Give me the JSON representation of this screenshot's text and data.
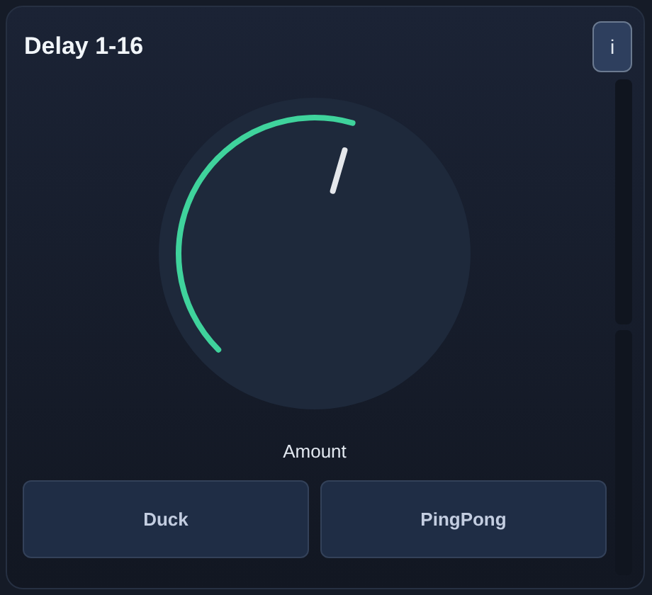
{
  "panel": {
    "title": "Delay 1-16",
    "info_button": "i"
  },
  "knob": {
    "label": "Amount"
  },
  "buttons": [
    {
      "label": "Duck"
    },
    {
      "label": "PingPong"
    }
  ]
}
